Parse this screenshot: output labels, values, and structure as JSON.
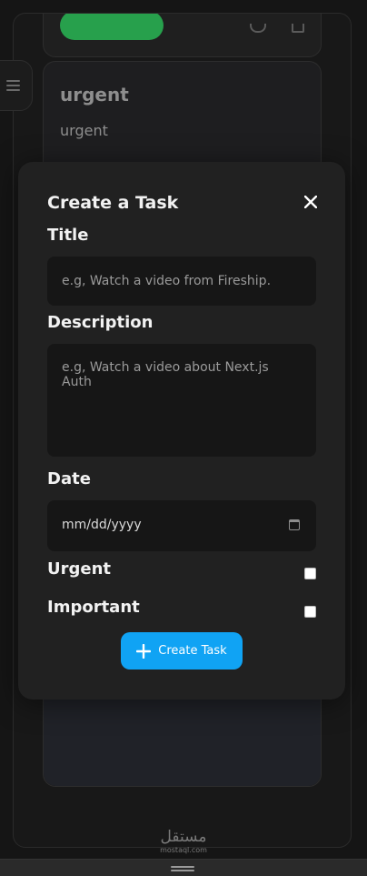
{
  "background_card": {
    "title": "urgent",
    "description": "urgent"
  },
  "modal": {
    "heading": "Create a Task",
    "close_glyph": "close-icon",
    "title_label": "Title",
    "title_placeholder": "e.g, Watch a video from Fireship.",
    "description_label": "Description",
    "description_placeholder": "e.g, Watch a video about Next.js Auth",
    "date_label": "Date",
    "date_value": "mm/dd/yyyy",
    "urgent_label": "Urgent",
    "urgent_checked": false,
    "important_label": "Important",
    "important_checked": false,
    "submit_label": "Create Task",
    "submit_icon": "plus-icon"
  },
  "watermark": {
    "arabic": "مستقل",
    "latin": "mostaql.com"
  },
  "colors": {
    "accent": "#10a3f4",
    "status_green": "#27a04c",
    "modal_bg": "#212121",
    "input_bg": "#161616"
  }
}
